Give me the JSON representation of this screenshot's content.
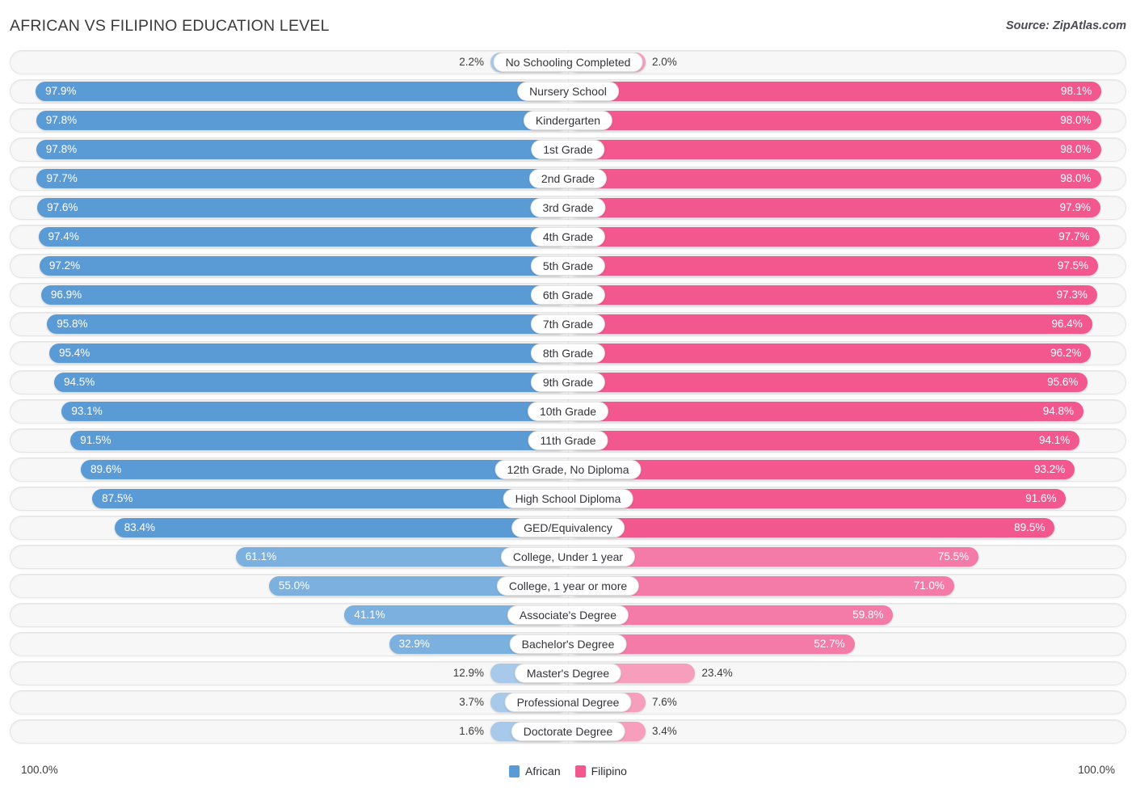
{
  "header": {
    "title": "AFRICAN VS FILIPINO EDUCATION LEVEL",
    "source": "Source: ZipAtlas.com"
  },
  "legend": {
    "african_label": "African",
    "filipino_label": "Filipino",
    "african_color": "#5b9bd5",
    "filipino_color": "#f2588e"
  },
  "axis": {
    "left_max": "100.0%",
    "right_max": "100.0%"
  },
  "chart_data": {
    "type": "bar",
    "title": "AFRICAN VS FILIPINO EDUCATION LEVEL",
    "subtitle": "Source: ZipAtlas.com",
    "orientation": "horizontal-diverging",
    "xlabel": "",
    "ylabel": "",
    "xlim": [
      0,
      100
    ],
    "grid": false,
    "legend_position": "bottom-center",
    "categories": [
      "No Schooling Completed",
      "Nursery School",
      "Kindergarten",
      "1st Grade",
      "2nd Grade",
      "3rd Grade",
      "4th Grade",
      "5th Grade",
      "6th Grade",
      "7th Grade",
      "8th Grade",
      "9th Grade",
      "10th Grade",
      "11th Grade",
      "12th Grade, No Diploma",
      "High School Diploma",
      "GED/Equivalency",
      "College, Under 1 year",
      "College, 1 year or more",
      "Associate's Degree",
      "Bachelor's Degree",
      "Master's Degree",
      "Professional Degree",
      "Doctorate Degree"
    ],
    "series": [
      {
        "name": "African",
        "color": "#5b9bd5",
        "values": [
          2.2,
          97.9,
          97.8,
          97.8,
          97.7,
          97.6,
          97.4,
          97.2,
          96.9,
          95.8,
          95.4,
          94.5,
          93.1,
          91.5,
          89.6,
          87.5,
          83.4,
          61.1,
          55.0,
          41.1,
          32.9,
          12.9,
          3.7,
          1.6
        ],
        "labels": [
          "2.2%",
          "97.9%",
          "97.8%",
          "97.8%",
          "97.7%",
          "97.6%",
          "97.4%",
          "97.2%",
          "96.9%",
          "95.8%",
          "95.4%",
          "94.5%",
          "93.1%",
          "91.5%",
          "89.6%",
          "87.5%",
          "83.4%",
          "61.1%",
          "55.0%",
          "41.1%",
          "32.9%",
          "12.9%",
          "3.7%",
          "1.6%"
        ]
      },
      {
        "name": "Filipino",
        "color": "#f2588e",
        "values": [
          2.0,
          98.1,
          98.0,
          98.0,
          98.0,
          97.9,
          97.7,
          97.5,
          97.3,
          96.4,
          96.2,
          95.6,
          94.8,
          94.1,
          93.2,
          91.6,
          89.5,
          75.5,
          71.0,
          59.8,
          52.7,
          23.4,
          7.6,
          3.4
        ],
        "labels": [
          "2.0%",
          "98.1%",
          "98.0%",
          "98.0%",
          "98.0%",
          "97.9%",
          "97.7%",
          "97.5%",
          "97.3%",
          "96.4%",
          "96.2%",
          "95.6%",
          "94.8%",
          "94.1%",
          "93.2%",
          "91.6%",
          "89.5%",
          "75.5%",
          "71.0%",
          "59.8%",
          "52.7%",
          "23.4%",
          "7.6%",
          "3.4%"
        ]
      }
    ]
  }
}
